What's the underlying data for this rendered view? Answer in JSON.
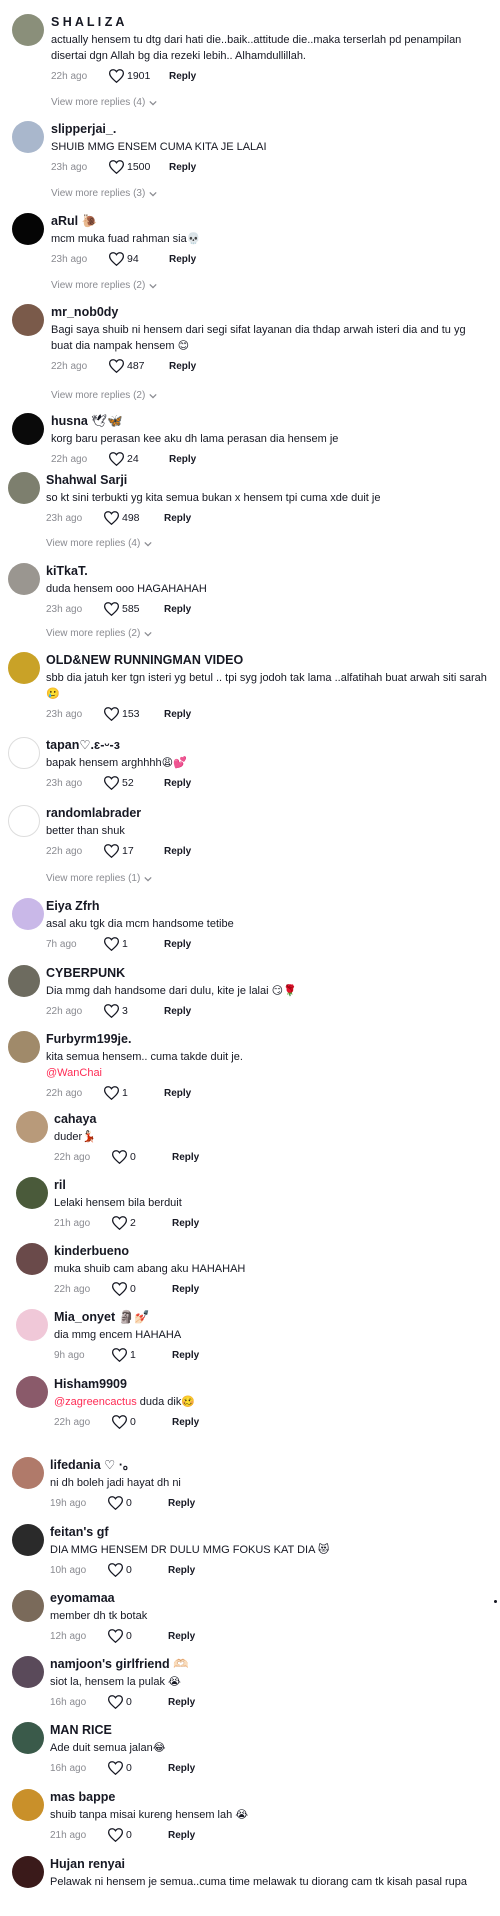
{
  "comments": [
    {
      "user": "S H A L I Z A",
      "user_emoji": "",
      "text": "actually hensem tu dtg dari hati die..baik..attitude die..maka terserlah pd penampilan disertai dgn Allah bg dia rezeki lebih.. Alhamdullillah.",
      "time": "22h ago",
      "likes": "1901",
      "reply": "Reply",
      "view_more": "View more replies (4)",
      "avatar_color": "#8a8f7a"
    },
    {
      "user": "slipperjai_.",
      "user_emoji": "",
      "text": "SHUIB MMG ENSEM CUMA KITA JE LALAI",
      "time": "23h ago",
      "likes": "1500",
      "reply": "Reply",
      "view_more": "View more replies (3)",
      "avatar_color": "#a9b7cc"
    },
    {
      "user": "aRul",
      "user_emoji": "🐌",
      "text": "mcm muka fuad rahman sia💀",
      "time": "23h ago",
      "likes": "94",
      "reply": "Reply",
      "view_more": "View more replies (2)",
      "avatar_color": "#050505"
    },
    {
      "user": "mr_nob0dy",
      "user_emoji": "",
      "text": "Bagi saya shuib ni hensem dari segi sifat layanan dia thdap arwah isteri dia and tu yg buat dia nampak hensem 😊",
      "time": "22h ago",
      "likes": "487",
      "reply": "Reply",
      "view_more": "View more replies (2)",
      "avatar_color": "#7a5a4a"
    },
    {
      "user": "husna",
      "user_emoji": "🕊🦋",
      "text": "korg baru perasan kee aku dh lama perasan dia hensem je",
      "time": "22h ago",
      "likes": "24",
      "reply": "Reply",
      "view_more": "",
      "avatar_color": "#0a0a0a"
    },
    {
      "user": "Shahwal Sarji",
      "user_emoji": "",
      "text": "so kt sini terbukti yg kita semua bukan x hensem tpi cuma xde duit je",
      "time": "23h ago",
      "likes": "498",
      "reply": "Reply",
      "view_more": "View more replies (4)",
      "avatar_color": "#7d7f6e"
    },
    {
      "user": "kiTkaT.",
      "user_emoji": "",
      "text": "duda hensem ooo HAGAHAHAH",
      "time": "23h ago",
      "likes": "585",
      "reply": "Reply",
      "view_more": "View more replies (2)",
      "avatar_color": "#9a9690"
    },
    {
      "user": "OLD&NEW RUNNINGMAN VIDEO",
      "user_emoji": "",
      "text": "sbb dia jatuh ker tgn isteri yg betul .. tpi syg jodoh tak lama ..alfatihah buat arwah siti sarah 🥲",
      "time": "23h ago",
      "likes": "153",
      "reply": "Reply",
      "view_more": "",
      "avatar_color": "#c9a227"
    },
    {
      "user": "tapan♡.ɛ-ᵕ-ɜ",
      "user_emoji": "",
      "text": "bapak hensem arghhhh😩💕",
      "time": "23h ago",
      "likes": "52",
      "reply": "Reply",
      "view_more": "",
      "avatar_color": "#ffffff"
    },
    {
      "user": "randomlabrader",
      "user_emoji": "",
      "text": "better than shuk",
      "time": "22h ago",
      "likes": "17",
      "reply": "Reply",
      "view_more": "View more replies (1)",
      "avatar_color": "#ffffff"
    },
    {
      "user": "Eiya Zfrh",
      "user_emoji": "",
      "text": "asal aku tgk dia mcm handsome tetibe",
      "time": "7h ago",
      "likes": "1",
      "reply": "Reply",
      "view_more": "",
      "avatar_color": "#c9b8e8"
    },
    {
      "user": "CYBERPUNK",
      "user_emoji": "",
      "text": "Dia mmg dah handsome dari dulu, kite je lalai 😏🌹",
      "time": "22h ago",
      "likes": "3",
      "reply": "Reply",
      "view_more": "",
      "avatar_color": "#6d6b5f"
    },
    {
      "user": "Furbyrm199je.",
      "user_emoji": "",
      "text": "kita semua hensem.. cuma takde duit je.",
      "mention": "@WanChai",
      "time": "22h ago",
      "likes": "1",
      "reply": "Reply",
      "view_more": "",
      "avatar_color": "#a08a6a"
    },
    {
      "user": "cahaya",
      "user_emoji": "",
      "text": "duder💃🏻",
      "time": "22h ago",
      "likes": "0",
      "reply": "Reply",
      "view_more": "",
      "avatar_color": "#b89a7a"
    },
    {
      "user": "ril",
      "user_emoji": "",
      "text": "Lelaki hensem bila berduit",
      "time": "21h ago",
      "likes": "2",
      "reply": "Reply",
      "view_more": "",
      "avatar_color": "#4a5a3a"
    },
    {
      "user": "kinderbueno",
      "user_emoji": "",
      "text": "muka shuib cam abang aku HAHAHAH",
      "time": "22h ago",
      "likes": "0",
      "reply": "Reply",
      "view_more": "",
      "avatar_color": "#6a4a4a"
    },
    {
      "user": "Mia_onyet",
      "user_emoji": "🗿💅🏻",
      "text": "dia mmg encem HAHAHA",
      "time": "9h ago",
      "likes": "1",
      "reply": "Reply",
      "view_more": "",
      "avatar_color": "#f0c8d8"
    },
    {
      "user": "Hisham9909",
      "user_emoji": "",
      "text": "duda dik🥴",
      "mention_inline": "@zagreencactus",
      "time": "22h ago",
      "likes": "0",
      "reply": "Reply",
      "view_more": "",
      "avatar_color": "#8a5a6a"
    },
    {
      "user": "lifedania ♡ ·｡",
      "user_emoji": "",
      "text": "ni dh boleh jadi hayat dh ni",
      "time": "19h ago",
      "likes": "0",
      "reply": "Reply",
      "view_more": "",
      "avatar_color": "#b07a6a"
    },
    {
      "user": "feitan's gf",
      "user_emoji": "",
      "text": "DIA MMG HENSEM DR DULU MMG FOKUS KAT DIA 😻",
      "time": "10h ago",
      "likes": "0",
      "reply": "Reply",
      "view_more": "",
      "avatar_color": "#2a2a2a"
    },
    {
      "user": "eyomamaa",
      "user_emoji": "",
      "text": "member dh tk botak",
      "time": "12h ago",
      "likes": "0",
      "reply": "Reply",
      "view_more": "",
      "avatar_color": "#7a6a5a"
    },
    {
      "user": "namjoon's girlfriend",
      "user_emoji": "🫶🏻",
      "text": "siot la, hensem la pulak 😭",
      "time": "16h ago",
      "likes": "0",
      "reply": "Reply",
      "view_more": "",
      "avatar_color": "#5a4a5a"
    },
    {
      "user": "MAN RICE",
      "user_emoji": "",
      "text": "Ade duit semua jalan😂",
      "time": "16h ago",
      "likes": "0",
      "reply": "Reply",
      "view_more": "",
      "avatar_color": "#3a5a4a"
    },
    {
      "user": "mas bappe",
      "user_emoji": "",
      "text": "shuib tanpa misai kureng hensem lah 😭",
      "time": "21h ago",
      "likes": "0",
      "reply": "Reply",
      "view_more": "",
      "avatar_color": "#c9902a"
    },
    {
      "user": "Hujan renyai",
      "user_emoji": "",
      "text": "Pelawak ni hensem je semua..cuma time melawak tu diorang cam tk kisah pasal rupa",
      "time": "",
      "likes": "",
      "reply": "",
      "view_more": "",
      "avatar_color": "#3a1a1a"
    }
  ]
}
